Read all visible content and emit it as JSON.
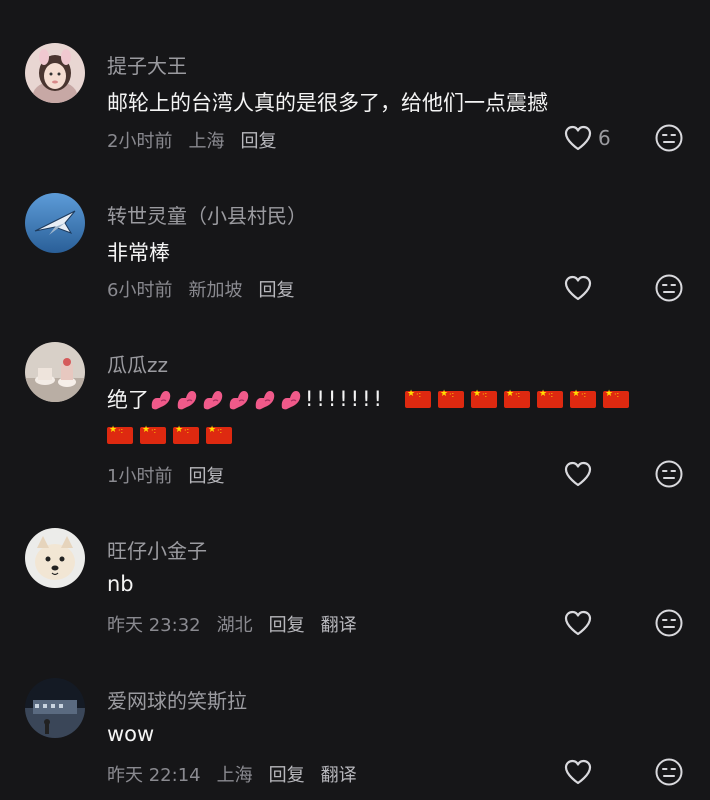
{
  "comments": [
    {
      "username": "提子大王",
      "text": "邮轮上的台湾人真的是很多了，给他们一点震撼",
      "time": "2小时前",
      "location": "上海",
      "reply": "回复",
      "likes": "6"
    },
    {
      "username": "转世灵童（小县村民）",
      "text": "非常棒",
      "time": "6小时前",
      "location": "新加坡",
      "reply": "回复"
    },
    {
      "username": "瓜瓜zz",
      "text_prefix": "绝了",
      "text_marks": "!!!!!!!",
      "muscle_emoji_count": 6,
      "flag_emoji_count": 11,
      "time": "1小时前",
      "reply": "回复"
    },
    {
      "username": "旺仔小金子",
      "text": "nb",
      "time": "昨天 23:32",
      "location": "湖北",
      "reply": "回复",
      "translate": "翻译"
    },
    {
      "username": "爱网球的笑斯拉",
      "text": "wow",
      "time": "昨天 22:14",
      "location": "上海",
      "reply": "回复",
      "translate": "翻译"
    }
  ],
  "icons": {
    "like": "heart-outline-icon",
    "emoji": "neutral-face-icon"
  },
  "colors": {
    "background": "#161618",
    "username": "#9b9ba0",
    "text": "#f4f4f4",
    "meta": "#8a8a90",
    "flag_red": "#de2910",
    "flag_yellow": "#ffde00",
    "muscle": "#f05a8a"
  }
}
